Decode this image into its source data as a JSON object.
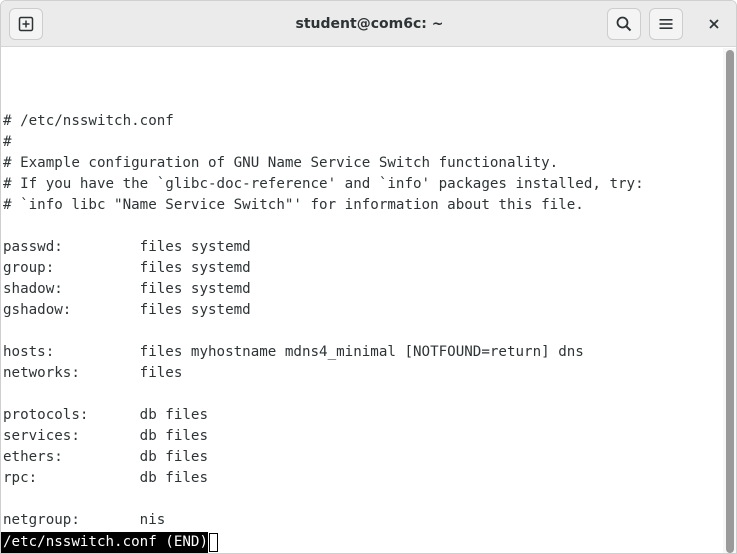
{
  "window": {
    "title": "student@com6c: ~"
  },
  "titlebar": {
    "new_tab_icon": "new-tab-icon",
    "search_icon": "search-icon",
    "menu_icon": "hamburger-menu-icon",
    "close_icon": "close-icon"
  },
  "terminal": {
    "lines": [
      "",
      "",
      "",
      "# /etc/nsswitch.conf",
      "#",
      "# Example configuration of GNU Name Service Switch functionality.",
      "# If you have the `glibc-doc-reference' and `info' packages installed, try:",
      "# `info libc \"Name Service Switch\"' for information about this file.",
      "",
      "passwd:         files systemd",
      "group:          files systemd",
      "shadow:         files systemd",
      "gshadow:        files systemd",
      "",
      "hosts:          files myhostname mdns4_minimal [NOTFOUND=return] dns",
      "networks:       files",
      "",
      "protocols:      db files",
      "services:       db files",
      "ethers:         db files",
      "rpc:            db files",
      "",
      "netgroup:       nis"
    ],
    "status": "/etc/nsswitch.conf (END)"
  },
  "colors": {
    "titlebar_bg": "#ebebeb",
    "terminal_bg": "#ffffff",
    "terminal_fg": "#2e3436",
    "status_bg": "#000000",
    "status_fg": "#ffffff"
  }
}
